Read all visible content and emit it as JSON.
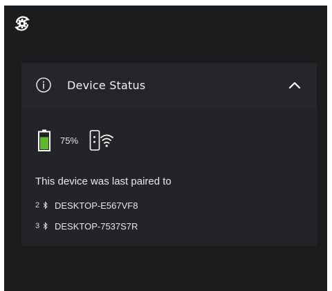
{
  "device_status": {
    "title": "Device Status",
    "expanded": true,
    "battery": {
      "level": 0.75,
      "percent_label": "75%",
      "color": "#5fb830"
    },
    "paired_label": "This device was last paired to",
    "paired_devices": [
      {
        "index": "2",
        "name": "DESKTOP-E567VF8"
      },
      {
        "index": "3",
        "name": "DESKTOP-7537S7R"
      }
    ]
  },
  "icons": {
    "sync": "sync-settings-icon",
    "info": "info-icon",
    "chevron": "chevron-up-icon",
    "battery": "battery-icon",
    "device_wifi": "device-wifi-icon",
    "bluetooth": "bluetooth-icon"
  }
}
